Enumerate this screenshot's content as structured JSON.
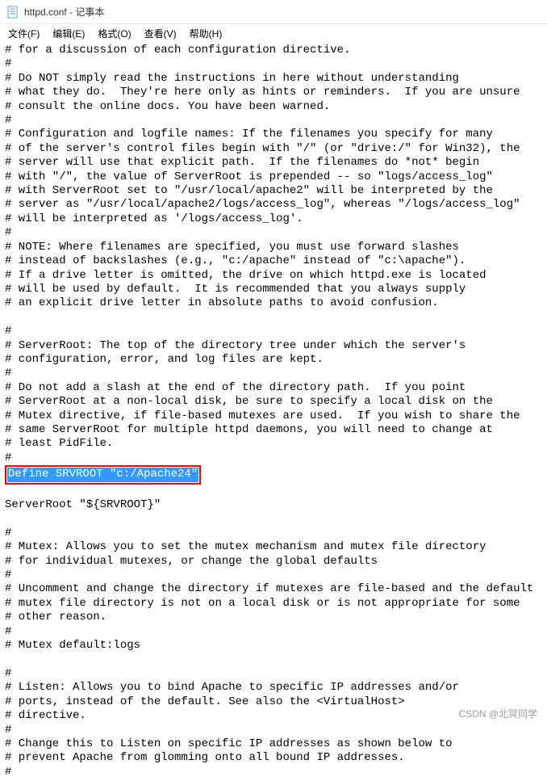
{
  "titlebar": {
    "title": "httpd.conf - 记事本",
    "icon_name": "notepad-icon"
  },
  "menubar": {
    "items": [
      {
        "label": "文件(F)"
      },
      {
        "label": "编辑(E)"
      },
      {
        "label": "格式(O)"
      },
      {
        "label": "查看(V)"
      },
      {
        "label": "帮助(H)"
      }
    ]
  },
  "content": {
    "block1": "# for a discussion of each configuration directive.\n#\n# Do NOT simply read the instructions in here without understanding\n# what they do.  They're here only as hints or reminders.  If you are unsure\n# consult the online docs. You have been warned.\n#\n# Configuration and logfile names: If the filenames you specify for many\n# of the server's control files begin with \"/\" (or \"drive:/\" for Win32), the\n# server will use that explicit path.  If the filenames do *not* begin\n# with \"/\", the value of ServerRoot is prepended -- so \"logs/access_log\"\n# with ServerRoot set to \"/usr/local/apache2\" will be interpreted by the\n# server as \"/usr/local/apache2/logs/access_log\", whereas \"/logs/access_log\"\n# will be interpreted as '/logs/access_log'.\n#\n# NOTE: Where filenames are specified, you must use forward slashes\n# instead of backslashes (e.g., \"c:/apache\" instead of \"c:\\apache\").\n# If a drive letter is omitted, the drive on which httpd.exe is located\n# will be used by default.  It is recommended that you always supply\n# an explicit drive letter in absolute paths to avoid confusion.\n\n#\n# ServerRoot: The top of the directory tree under which the server's\n# configuration, error, and log files are kept.\n#\n# Do not add a slash at the end of the directory path.  If you point\n# ServerRoot at a non-local disk, be sure to specify a local disk on the\n# Mutex directive, if file-based mutexes are used.  If you wish to share the\n# same ServerRoot for multiple httpd daemons, you will need to change at\n# least PidFile.\n#",
    "highlighted": "Define SRVROOT \"c:/Apache24\"",
    "block2": "\nServerRoot \"${SRVROOT}\"\n\n#\n# Mutex: Allows you to set the mutex mechanism and mutex file directory\n# for individual mutexes, or change the global defaults\n#\n# Uncomment and change the directory if mutexes are file-based and the default\n# mutex file directory is not on a local disk or is not appropriate for some\n# other reason.\n#\n# Mutex default:logs\n\n#\n# Listen: Allows you to bind Apache to specific IP addresses and/or\n# ports, instead of the default. See also the <VirtualHost>\n# directive.\n#\n# Change this to Listen on specific IP addresses as shown below to\n# prevent Apache from glomming onto all bound IP addresses.\n#"
  },
  "watermark": "CSDN @北冥同学"
}
